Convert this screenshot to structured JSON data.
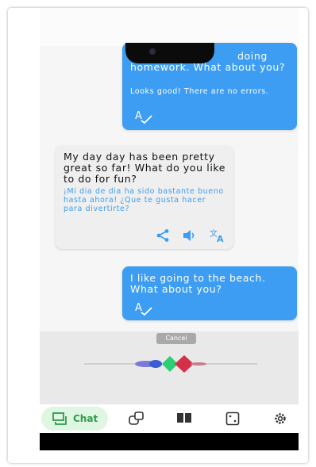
{
  "colors": {
    "accent_blue": "#3d9df2",
    "bubble_grey": "#efefef",
    "translation_blue": "#3d9df2",
    "chat_green": "#2e9b4c"
  },
  "messages": [
    {
      "side": "right",
      "text": "doing homework. What about you?",
      "note": "Looks good! There are no errors.",
      "icons": [
        "spellcheck-icon"
      ]
    },
    {
      "side": "left",
      "text": "My day day has been pretty great so far! What do you like to do for fun?",
      "translation": "¡Mi dia de dia ha sido bastante bueno hasta ahora! ¿Que te gusta hacer para divertirte?",
      "icons": [
        "share-icon",
        "speaker-icon",
        "translate-icon"
      ]
    },
    {
      "side": "right",
      "text": "I like going to the beach. What about you?",
      "icons": [
        "spellcheck-icon"
      ]
    }
  ],
  "recorder": {
    "cancel_label": "Cancel"
  },
  "nav": {
    "chat_label": "Chat",
    "items": [
      "chat-icon",
      "vocab-icon",
      "book-icon",
      "dice-icon",
      "settings-icon"
    ]
  }
}
